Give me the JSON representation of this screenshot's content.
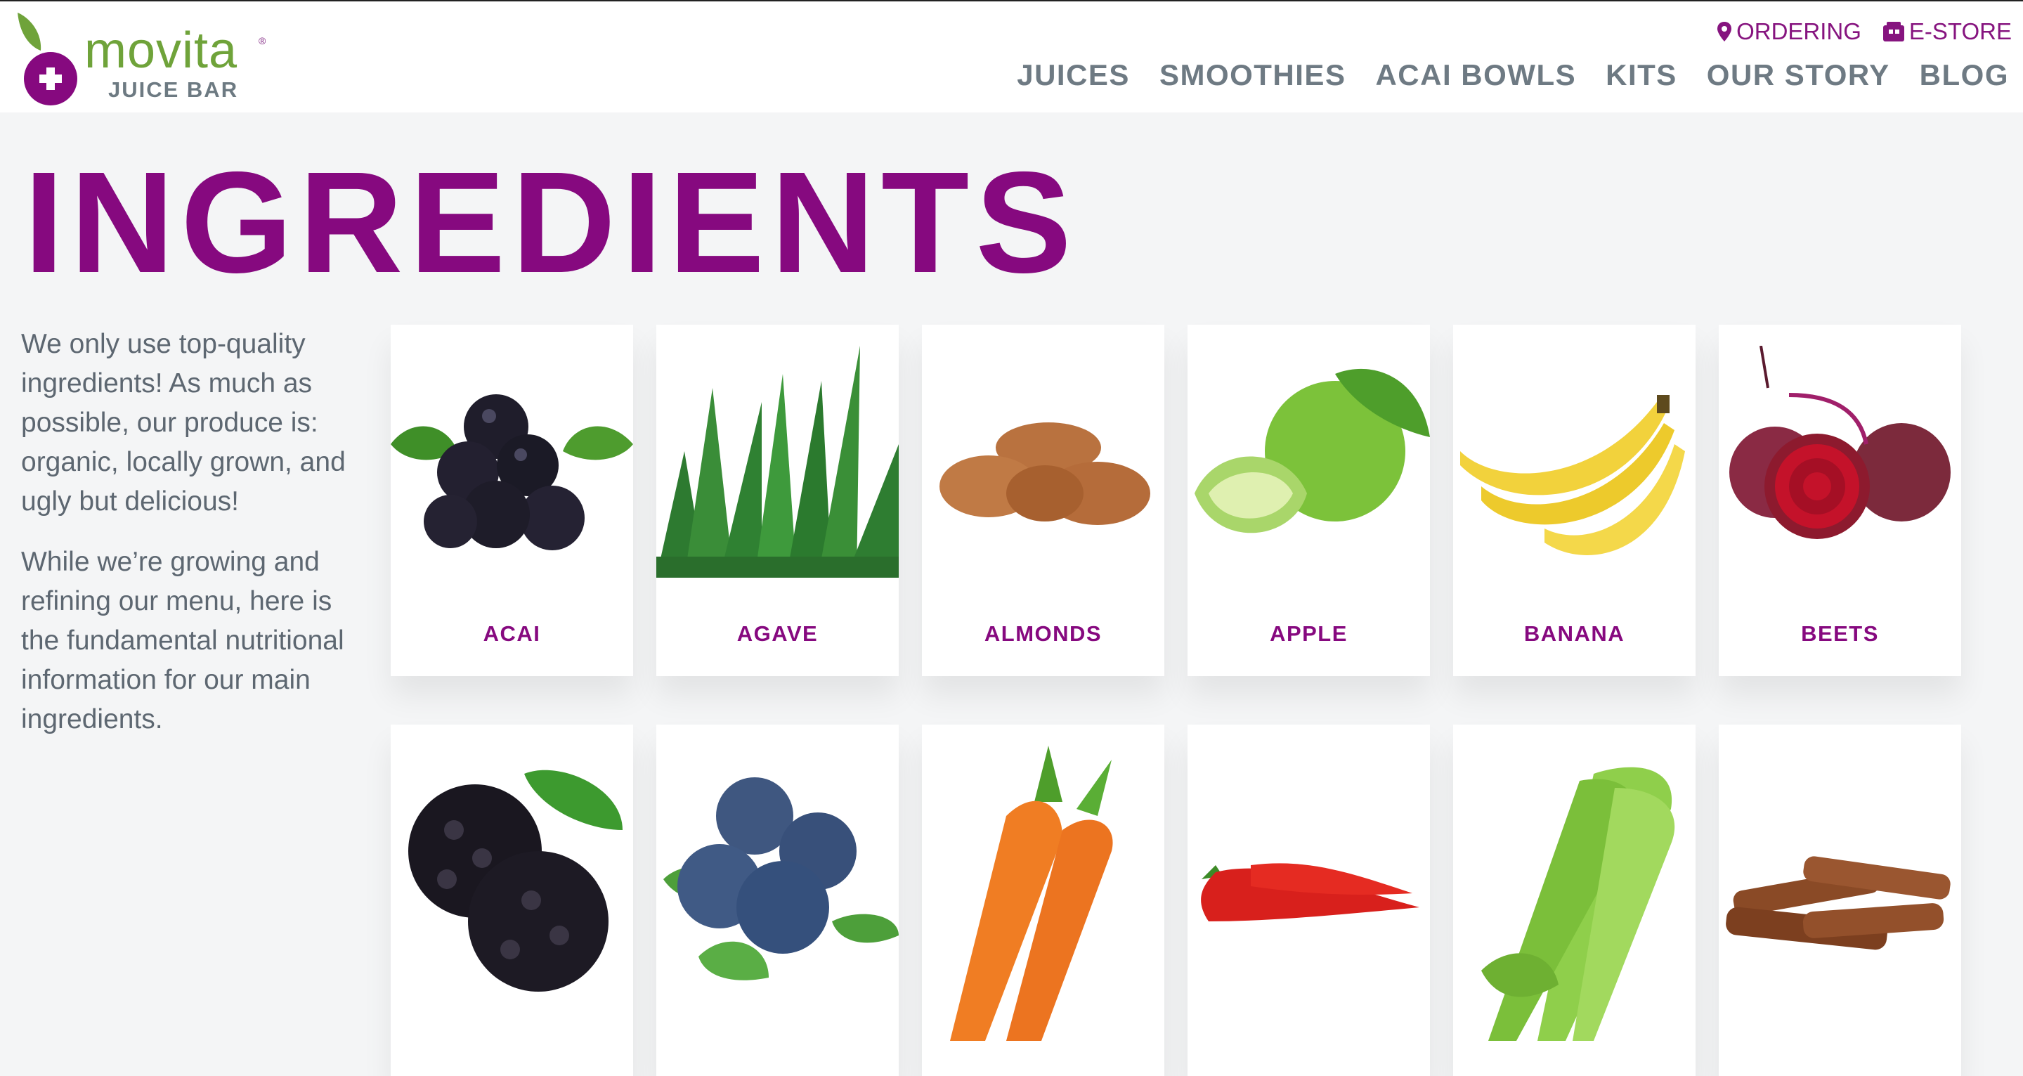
{
  "brand": {
    "name": "movita",
    "sub": "JUICE BAR",
    "reg": "®"
  },
  "utility": [
    {
      "label": "ORDERING",
      "icon": "map-pin-icon"
    },
    {
      "label": "E-STORE",
      "icon": "store-icon"
    }
  ],
  "nav": [
    "JUICES",
    "SMOOTHIES",
    "ACAI BOWLS",
    "KITS",
    "OUR STORY",
    "BLOG"
  ],
  "page_title": "INGREDIENTS",
  "intro": [
    "We only use top-quality ingredients! As much as possible, our produce is: organic, locally grown, and ugly but delicious!",
    "While we’re growing and refining our menu, here is the fundamental nutritional information for our main ingredients."
  ],
  "ingredients_row1": [
    "ACAI",
    "AGAVE",
    "ALMONDS",
    "APPLE",
    "BANANA",
    "BEETS"
  ],
  "colors": {
    "accent": "#86097f",
    "brand_green": "#6fa33a",
    "nav_gray": "#6e7a83",
    "text_gray": "#5d6771"
  }
}
